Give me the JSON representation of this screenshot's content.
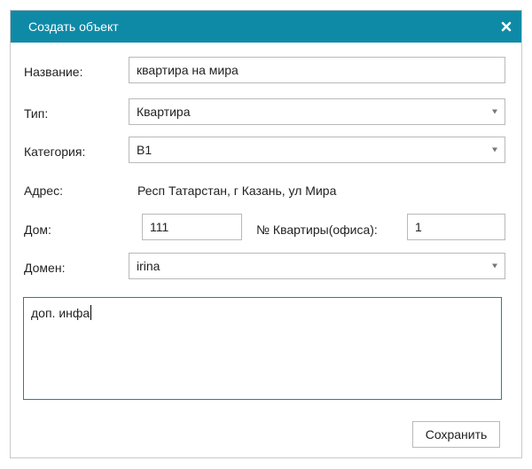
{
  "dialog": {
    "title": "Создать объект",
    "close_icon": "close-icon",
    "header_color": "#0e8aa7"
  },
  "form": {
    "name": {
      "label": "Название:",
      "value": "квартира на мира"
    },
    "type": {
      "label": "Тип:",
      "value": "Квартира"
    },
    "category": {
      "label": "Категория:",
      "value": "B1"
    },
    "address": {
      "label": "Адрес:",
      "value": "Респ Татарстан, г Казань, ул Мира"
    },
    "house": {
      "label": "Дом:",
      "value": "111"
    },
    "apartment": {
      "label": "№ Квартиры(офиса):",
      "value": "1"
    },
    "domain": {
      "label": "Домен:",
      "value": "irina"
    },
    "notes": {
      "value": "доп. инфа"
    }
  },
  "actions": {
    "save_label": "Сохранить"
  }
}
